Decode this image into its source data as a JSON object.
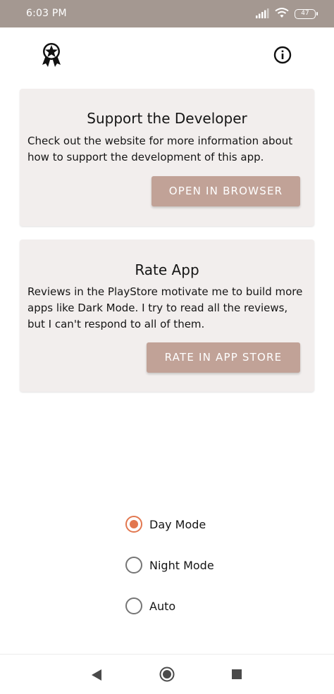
{
  "status_bar": {
    "time": "6:03 PM",
    "battery_level": "47",
    "icons": [
      "signal-icon",
      "wifi-icon",
      "battery-icon"
    ]
  },
  "app_bar": {
    "icons": [
      "award-icon",
      "info-icon"
    ]
  },
  "support_card": {
    "title": "Support the Developer",
    "body": "Check out the website for more information about how to support the development of this app.",
    "button_label": "OPEN IN BROWSER"
  },
  "rate_card": {
    "title": "Rate App",
    "body": "Reviews in the PlayStore motivate me to build more apps like Dark Mode. I try to read all the reviews, but I can't respond to all of them.",
    "button_label": "RATE IN APP STORE"
  },
  "theme_options": {
    "selected": "Day Mode",
    "items": [
      {
        "label": "Day Mode",
        "checked": true
      },
      {
        "label": "Night Mode",
        "checked": false
      },
      {
        "label": "Auto",
        "checked": false
      }
    ]
  },
  "colors": {
    "status_bar": "#a49891",
    "card_background": "#f2eeed",
    "button": "#c1a297",
    "radio_accent": "#e2774f"
  },
  "nav_bar": {
    "icons": [
      "back-icon",
      "home-icon",
      "recents-icon"
    ]
  }
}
